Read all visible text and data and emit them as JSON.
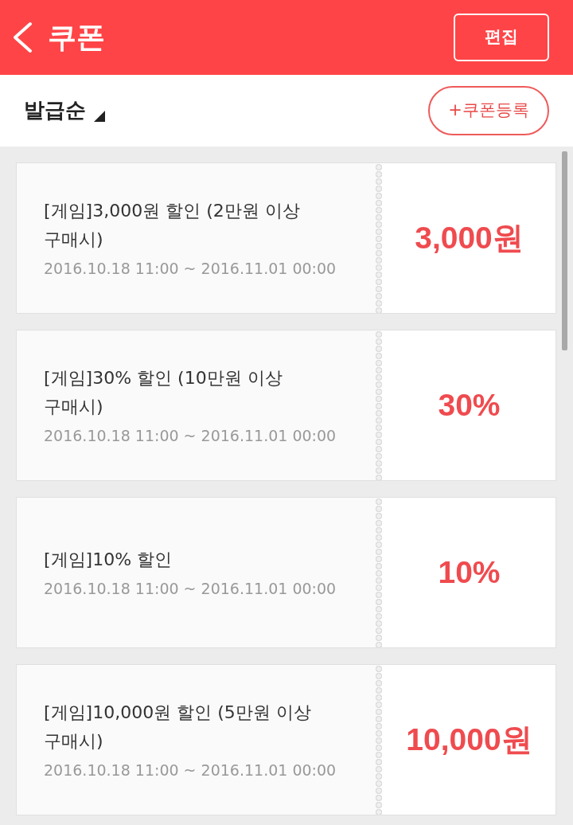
{
  "header": {
    "title": "쿠폰",
    "edit_button": "편집"
  },
  "toolbar": {
    "sort_label": "발급순",
    "register_button": "+쿠폰등록"
  },
  "coupons": [
    {
      "title": "[게임]3,000원 할인 (2만원 이상 구매시)",
      "period": "2016.10.18 11:00 ~ 2016.11.01 00:00",
      "value": "3,000원"
    },
    {
      "title": "[게임]30% 할인 (10만원 이상 구매시)",
      "period": "2016.10.18 11:00 ~ 2016.11.01 00:00",
      "value": "30%"
    },
    {
      "title": "[게임]10% 할인",
      "period": "2016.10.18 11:00 ~ 2016.11.01 00:00",
      "value": "10%"
    },
    {
      "title": "[게임]10,000원 할인 (5만원 이상 구매시)",
      "period": "2016.10.18 11:00 ~ 2016.11.01 00:00",
      "value": "10,000원"
    }
  ]
}
